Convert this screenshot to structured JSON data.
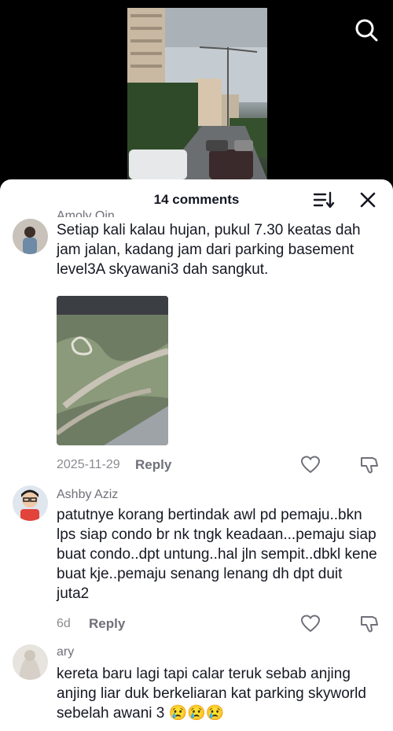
{
  "header": {
    "comments_count": "14 comments"
  },
  "comments": [
    {
      "username": "Amoly Qin",
      "text": "Setiap kali kalau hujan, pukul 7.30 keatas dah jam jalan, kadang jam dari parking basement level3A skyawani3 dah sangkut.",
      "date": "2025-11-29",
      "reply_label": "Reply"
    },
    {
      "username": "Ashby Aziz",
      "text": "patutnye korang bertindak awl pd pemaju..bkn lps siap condo br nk tngk keadaan...pemaju siap buat condo..dpt untung..hal jln sempit..dbkl kene buat kje..pemaju senang lenang dh dpt duit juta2",
      "date": "6d",
      "reply_label": "Reply"
    },
    {
      "username": "ary",
      "text": "kereta baru lagi tapi calar teruk sebab anjing anjing liar duk berkeliaran kat parking skyworld sebelah awani 3 😢😢😢"
    }
  ],
  "colors": {
    "text_primary": "#161823",
    "text_secondary": "#8a8b91",
    "sheet_bg": "#ffffff",
    "page_bg": "#000000"
  }
}
